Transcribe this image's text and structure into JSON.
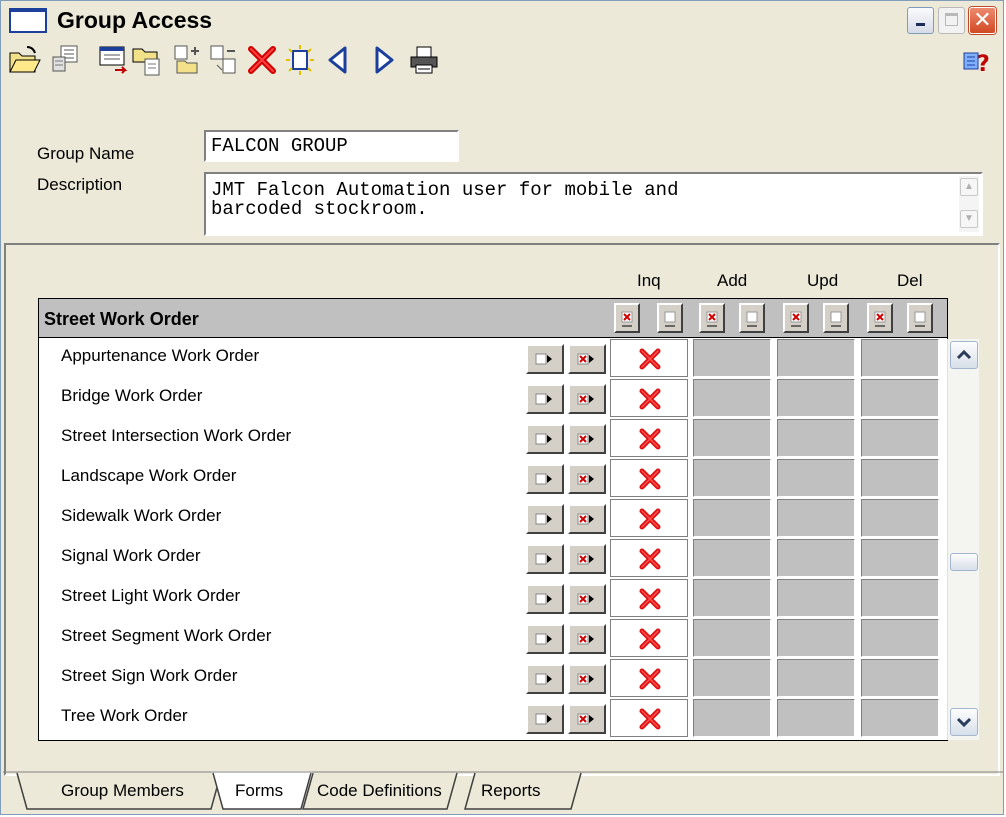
{
  "window": {
    "title": "Group Access"
  },
  "toolbar": {
    "buttons": [
      "open-folder-icon",
      "insert-record-icon",
      "form-view-icon",
      "open-to-record-icon",
      "add-record-icon",
      "copy-record-icon",
      "delete-icon",
      "new-page-icon",
      "previous-icon",
      "next-icon",
      "print-icon",
      "help-icon"
    ]
  },
  "form": {
    "group_name_label": "Group Name",
    "group_name_value": "FALCON GROUP",
    "description_label": "Description",
    "description_value": "JMT Falcon Automation user for mobile and\nbarcoded stockroom."
  },
  "permissions": {
    "columns": [
      "Inq",
      "Add",
      "Upd",
      "Del"
    ],
    "group": "Street Work Order",
    "rows": [
      {
        "name": "Appurtenance Work Order",
        "inq": true
      },
      {
        "name": "Bridge Work Order",
        "inq": true
      },
      {
        "name": "Street Intersection Work Order",
        "inq": true
      },
      {
        "name": "Landscape Work Order",
        "inq": true
      },
      {
        "name": "Sidewalk Work Order",
        "inq": true
      },
      {
        "name": "Signal Work Order",
        "inq": true
      },
      {
        "name": "Street Light Work Order",
        "inq": true
      },
      {
        "name": "Street Segment Work Order",
        "inq": true
      },
      {
        "name": "Street Sign Work Order",
        "inq": true
      },
      {
        "name": "Tree Work Order",
        "inq": true
      }
    ]
  },
  "tabs": [
    {
      "label": "Group Members",
      "active": false
    },
    {
      "label": "Forms",
      "active": true
    },
    {
      "label": "Code Definitions",
      "active": false
    },
    {
      "label": "Reports",
      "active": false
    }
  ],
  "colors": {
    "accent": "#1b3f9b",
    "x_mark": "#e01010",
    "cell_gray": "#c0c0c0"
  }
}
